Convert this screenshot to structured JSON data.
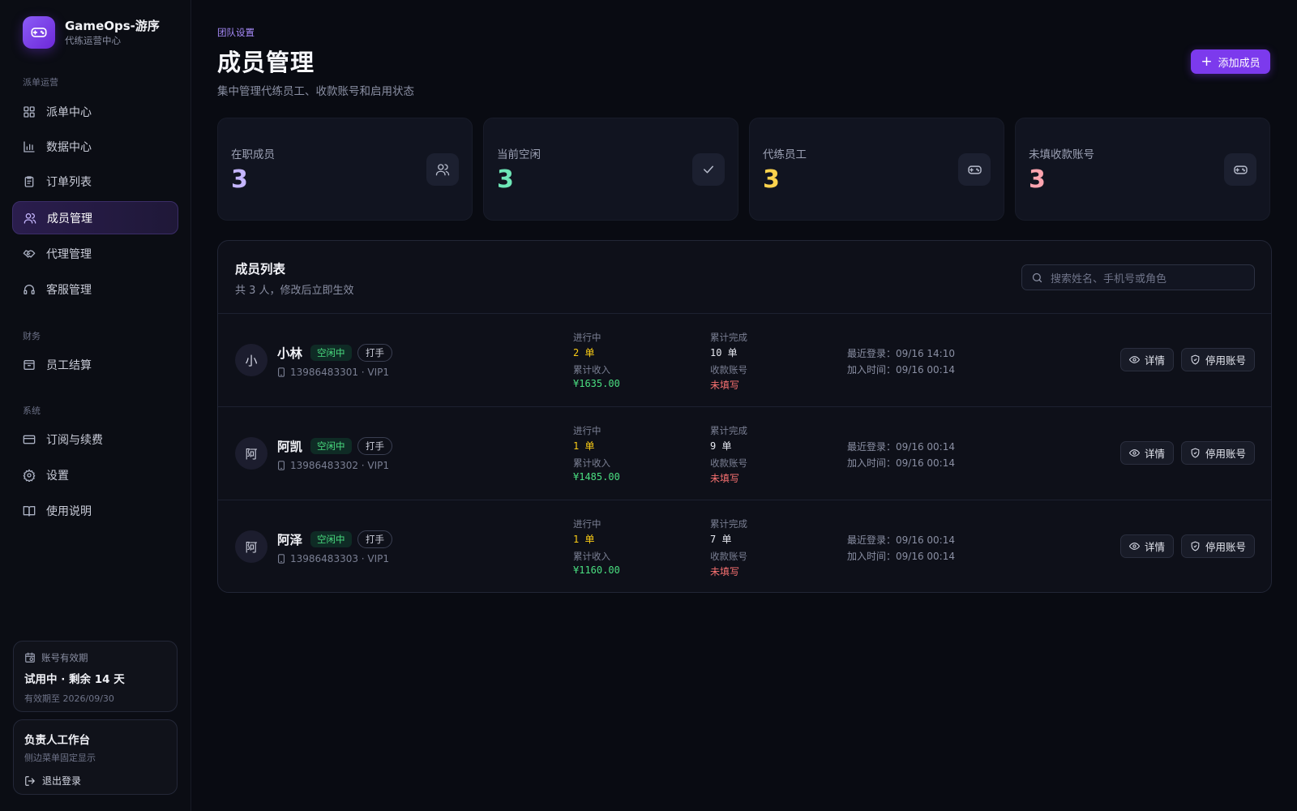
{
  "brand": {
    "name": "GameOps-游序",
    "subtitle": "代练运营中心"
  },
  "sidebar": {
    "sections": [
      "派单运营",
      "财务",
      "系统"
    ],
    "items": [
      {
        "label": "派单中心",
        "icon": "grid-icon"
      },
      {
        "label": "数据中心",
        "icon": "bar-chart-icon"
      },
      {
        "label": "订单列表",
        "icon": "clipboard-icon"
      },
      {
        "label": "成员管理",
        "icon": "users-icon",
        "active": true
      },
      {
        "label": "代理管理",
        "icon": "handshake-icon"
      },
      {
        "label": "客服管理",
        "icon": "headset-icon"
      },
      {
        "label": "员工结算",
        "icon": "archive-icon"
      },
      {
        "label": "订阅与续费",
        "icon": "credit-card-icon"
      },
      {
        "label": "设置",
        "icon": "gear-icon"
      },
      {
        "label": "使用说明",
        "icon": "book-icon"
      }
    ],
    "account_card": {
      "label": "账号有效期",
      "status": "试用中 · 剩余 14 天",
      "expiry": "有效期至 2026/09/30"
    },
    "workspace_card": {
      "title": "负责人工作台",
      "subtitle": "侧边菜单固定显示",
      "logout": "退出登录"
    }
  },
  "header": {
    "breadcrumb": "团队设置",
    "title": "成员管理",
    "subtitle": "集中管理代练员工、收款账号和启用状态",
    "add_button": "添加成员"
  },
  "stats": [
    {
      "label": "在职成员",
      "value": "3",
      "color": "#c4b5fd",
      "icon": "users-icon"
    },
    {
      "label": "当前空闲",
      "value": "3",
      "color": "#6ee7b7",
      "icon": "check-icon"
    },
    {
      "label": "代练员工",
      "value": "3",
      "color": "#fcd34d",
      "icon": "gamepad-icon"
    },
    {
      "label": "未填收款账号",
      "value": "3",
      "color": "#fda4af",
      "icon": "gamepad-icon"
    }
  ],
  "member_list": {
    "title": "成员列表",
    "subtitle": "共 3 人，修改后立即生效",
    "search_placeholder": "搜索姓名、手机号或角色",
    "labels": {
      "in_progress": "进行中",
      "completed": "累计完成",
      "income": "累计收入",
      "account": "收款账号",
      "detail_button": "详情",
      "disable_button": "停用账号"
    },
    "members": [
      {
        "avatar": "小",
        "name": "小林",
        "status": "空闲中",
        "role": "打手",
        "phone": "13986483301 · VIP1",
        "in_progress": "2 单",
        "completed": "10 单",
        "income": "¥1635.00",
        "account": "未填写",
        "last_login": "最近登录：09/16 14:10",
        "joined": "加入时间：09/16 00:14"
      },
      {
        "avatar": "阿",
        "name": "阿凯",
        "status": "空闲中",
        "role": "打手",
        "phone": "13986483302 · VIP1",
        "in_progress": "1 单",
        "completed": "9 单",
        "income": "¥1485.00",
        "account": "未填写",
        "last_login": "最近登录：09/16 00:14",
        "joined": "加入时间：09/16 00:14"
      },
      {
        "avatar": "阿",
        "name": "阿泽",
        "status": "空闲中",
        "role": "打手",
        "phone": "13986483303 · VIP1",
        "in_progress": "1 单",
        "completed": "7 单",
        "income": "¥1160.00",
        "account": "未填写",
        "last_login": "最近登录：09/16 00:14",
        "joined": "加入时间：09/16 00:14"
      }
    ]
  }
}
